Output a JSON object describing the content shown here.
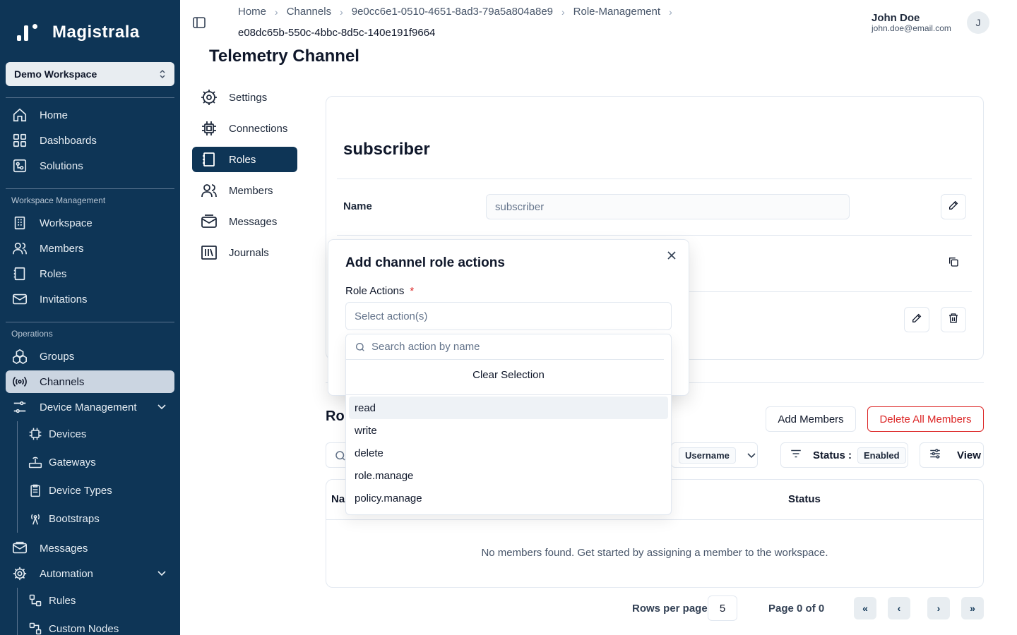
{
  "sidebar": {
    "brand": "Magistrala",
    "workspace": "Demo Workspace",
    "items_top": [
      {
        "label": "Home",
        "icon": "home-icon"
      },
      {
        "label": "Dashboards",
        "icon": "dashboard-icon"
      },
      {
        "label": "Solutions",
        "icon": "solutions-icon"
      }
    ],
    "section_ws": "Workspace Management",
    "items_ws": [
      {
        "label": "Workspace",
        "icon": "building-icon"
      },
      {
        "label": "Members",
        "icon": "users-icon"
      },
      {
        "label": "Roles",
        "icon": "book-icon"
      },
      {
        "label": "Invitations",
        "icon": "mail-icon"
      }
    ],
    "section_ops": "Operations",
    "items_ops": [
      {
        "label": "Groups",
        "icon": "groups-icon"
      },
      {
        "label": "Channels",
        "icon": "radio-icon"
      },
      {
        "label": "Device Management",
        "icon": "sliders-icon"
      }
    ],
    "device_sub": [
      {
        "label": "Devices",
        "icon": "chip-icon"
      },
      {
        "label": "Gateways",
        "icon": "router-icon"
      },
      {
        "label": "Device Types",
        "icon": "clipboard-icon"
      },
      {
        "label": "Bootstraps",
        "icon": "antenna-icon"
      }
    ],
    "items_bottom": [
      {
        "label": "Messages",
        "icon": "mail-open-icon"
      },
      {
        "label": "Automation",
        "icon": "gear-icon"
      }
    ],
    "automation_sub": [
      {
        "label": "Rules",
        "icon": "rules-icon"
      },
      {
        "label": "Custom Nodes",
        "icon": "nodes-icon"
      }
    ]
  },
  "header": {
    "breadcrumb": [
      "Home",
      "Channels",
      "9e0cc6e1-0510-4651-8ad3-79a5a804a8e9",
      "Role-Management"
    ],
    "breadcrumb_last": "e08dc65b-550c-4bbc-8d5c-140e191f9664",
    "user_name": "John Doe",
    "user_email": "john.doe@email.com",
    "avatar_initial": "J"
  },
  "page": {
    "title": "Telemetry Channel",
    "tabs": [
      {
        "label": "Settings",
        "icon": "gear-icon"
      },
      {
        "label": "Connections",
        "icon": "chip-icon"
      },
      {
        "label": "Roles",
        "icon": "book-icon"
      },
      {
        "label": "Members",
        "icon": "users-icon"
      },
      {
        "label": "Messages",
        "icon": "mail-open-icon"
      },
      {
        "label": "Journals",
        "icon": "library-icon"
      }
    ],
    "active_tab": "Roles"
  },
  "role": {
    "name": "subscriber",
    "name_label": "Name",
    "name_value": "subscriber"
  },
  "members": {
    "title_partial": "Rol",
    "add_button": "Add Members",
    "delete_all_button": "Delete All Members",
    "filter_field": "Username",
    "status_label": "Status :",
    "status_value": "Enabled",
    "view_button": "View",
    "col_name_partial": "Na",
    "col_status": "Status",
    "empty_message": "No members found. Get started by assigning a member to the workspace.",
    "rows_per_page_label": "Rows per page",
    "rows_per_page": "5",
    "page_info": "Page 0 of 0"
  },
  "dialog": {
    "title": "Add channel role actions",
    "field_label": "Role Actions",
    "required_mark": "*",
    "select_placeholder": "Select action(s)",
    "search_placeholder": "Search action by name",
    "clear_selection": "Clear Selection",
    "options": [
      "read",
      "write",
      "delete",
      "role.manage",
      "policy.manage"
    ]
  },
  "colors": {
    "sidebar_bg": "#0e3556",
    "accent": "#0e3556",
    "danger": "#dc2626"
  }
}
